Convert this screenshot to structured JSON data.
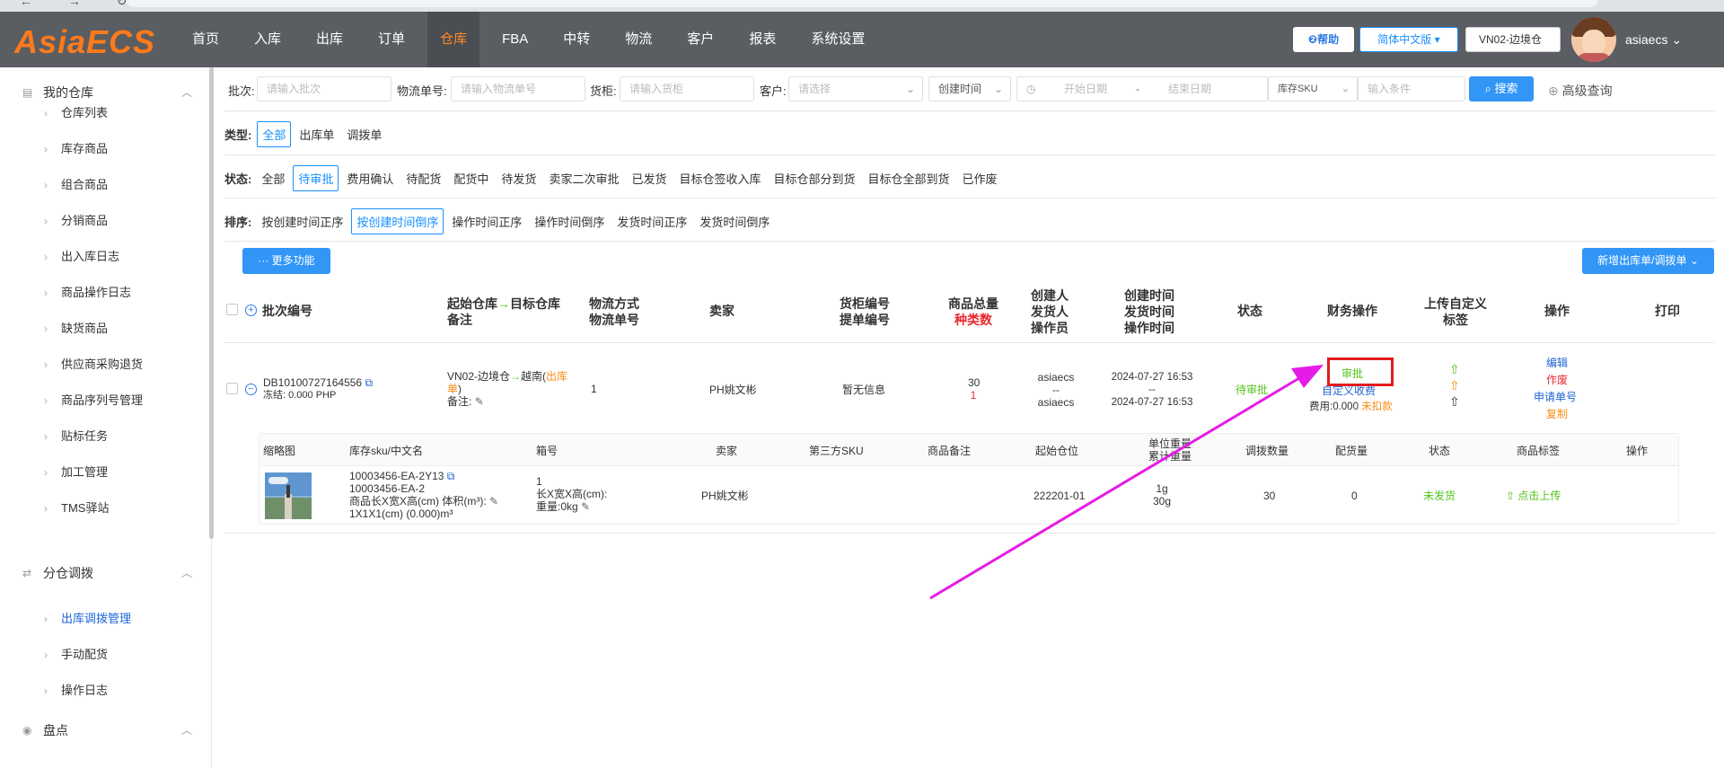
{
  "browser": {
    "nav_glyphs": "← → ↻"
  },
  "app": {
    "logo": "AsiaECS"
  },
  "nav": {
    "items": [
      "首页",
      "入库",
      "出库",
      "订单",
      "仓库",
      "FBA",
      "中转",
      "物流",
      "客户",
      "报表",
      "系统设置"
    ],
    "active_index": 4
  },
  "header": {
    "help": "❷帮助",
    "language": "简体中文版",
    "warehouse": "VN02-边境仓",
    "username": "asiaecs"
  },
  "sidebar": {
    "group1": "我的仓库",
    "group1_items": [
      "仓库列表",
      "库存商品",
      "组合商品",
      "分销商品",
      "出入库日志",
      "商品操作日志",
      "缺货商品",
      "供应商采购退货",
      "商品序列号管理",
      "贴标任务",
      "加工管理",
      "TMS驿站"
    ],
    "group2": "分仓调拨",
    "group2_items": [
      "出库调拨管理",
      "手动配货",
      "操作日志"
    ],
    "group2_active": "出库调拨管理",
    "group3": "盘点"
  },
  "filters": {
    "batch_label": "批次:",
    "batch_ph": "请输入批次",
    "logistics_label": "物流单号:",
    "logistics_ph": "请输入物流单号",
    "cabinet_label": "货柜:",
    "cabinet_ph": "请输入货柜",
    "customer_label": "客户:",
    "customer_ph": "请选择",
    "time_type": "创建时间",
    "date_start": "开始日期",
    "date_sep": "-",
    "date_end": "结束日期",
    "sku_type": "库存SKU",
    "cond_ph": "输入条件",
    "search": "搜索",
    "advanced": "高级查询"
  },
  "type_row": {
    "label": "类型:",
    "options": [
      "全部",
      "出库单",
      "调拨单"
    ],
    "selected": "全部"
  },
  "status_row": {
    "label": "状态:",
    "options": [
      "全部",
      "待审批",
      "费用确认",
      "待配货",
      "配货中",
      "待发货",
      "卖家二次审批",
      "已发货",
      "目标仓签收入库",
      "目标仓部分到货",
      "目标仓全部到货",
      "已作废"
    ],
    "selected": "待审批"
  },
  "sort_row": {
    "label": "排序:",
    "options": [
      "按创建时间正序",
      "按创建时间倒序",
      "操作时间正序",
      "操作时间倒序",
      "发货时间正序",
      "发货时间倒序"
    ],
    "selected": "按创建时间倒序"
  },
  "actions": {
    "more": "··· 更多功能",
    "new": "新增出库单/调拨单"
  },
  "table_headers": {
    "batch": "批次编号",
    "wh_from": "起始仓库",
    "wh_to": "目标仓库",
    "remark": "备注",
    "ship_method": "物流方式",
    "logistics_no": "物流单号",
    "seller": "卖家",
    "cabinet_no": "货柜编号",
    "bill_no": "提单编号",
    "qty_total": "商品总量",
    "kinds": "种类数",
    "creator": "创建人",
    "shipper": "发货人",
    "operator": "操作员",
    "create_time": "创建时间",
    "ship_time": "发货时间",
    "op_time": "操作时间",
    "status": "状态",
    "finance": "财务操作",
    "upload_label1": "上传自定义",
    "upload_label2": "标签",
    "ops": "操作",
    "print": "打印"
  },
  "row": {
    "batch_no": "DB10100727164556",
    "frozen": "冻结: 0.000 PHP",
    "wh_from": "VN02-边境仓",
    "wh_to_prefix": "越南(",
    "wh_to_link1": "出库",
    "wh_to_link2": "单",
    "wh_to_suffix": ")",
    "remark_label": "备注:",
    "ship_method": "1",
    "seller": "PH姚文彬",
    "cabinet": "暂无信息",
    "qty": "30",
    "kinds": "1",
    "creator": "asiaecs",
    "shipper": "--",
    "operator": "asiaecs",
    "create_time": "2024-07-27 16:53",
    "ship_time": "--",
    "op_time": "2024-07-27 16:53",
    "status": "待审批",
    "fin_approve": "审批",
    "fin_custom": "自定义收费",
    "fin_fee": "费用:0.000",
    "fin_unpaid": "未扣款",
    "ops": [
      "编辑",
      "作废",
      "申请单号",
      "复制"
    ]
  },
  "sub_headers": {
    "thumb": "缩略图",
    "sku": "库存sku/中文名",
    "box": "箱号",
    "seller": "卖家",
    "third_sku": "第三方SKU",
    "remark": "商品备注",
    "loc": "起始仓位",
    "unit_weight": "单位重量",
    "total_weight": "累计重量",
    "transfer_qty": "调拨数量",
    "alloc_qty": "配货量",
    "status": "状态",
    "tag": "商品标签",
    "ops": "操作"
  },
  "sub_row": {
    "sku1": "10003456-EA-2Y13",
    "sku2": "10003456-EA-2",
    "dims_label": "商品长X宽X高(cm) 体积(m³):",
    "dims_value": "1X1X1(cm) (0.000)m³",
    "box": "1",
    "box_dims": "长X宽X高(cm):",
    "box_weight": "重量:0kg",
    "seller": "PH姚文彬",
    "loc": "222201-01",
    "unit_weight": "1g",
    "total_weight": "30g",
    "transfer_qty": "30",
    "alloc_qty": "0",
    "status": "未发货",
    "tag": "点击上传"
  },
  "annotation": {
    "arrow_color": "#e61be6",
    "box_color": "#e21d1d"
  }
}
